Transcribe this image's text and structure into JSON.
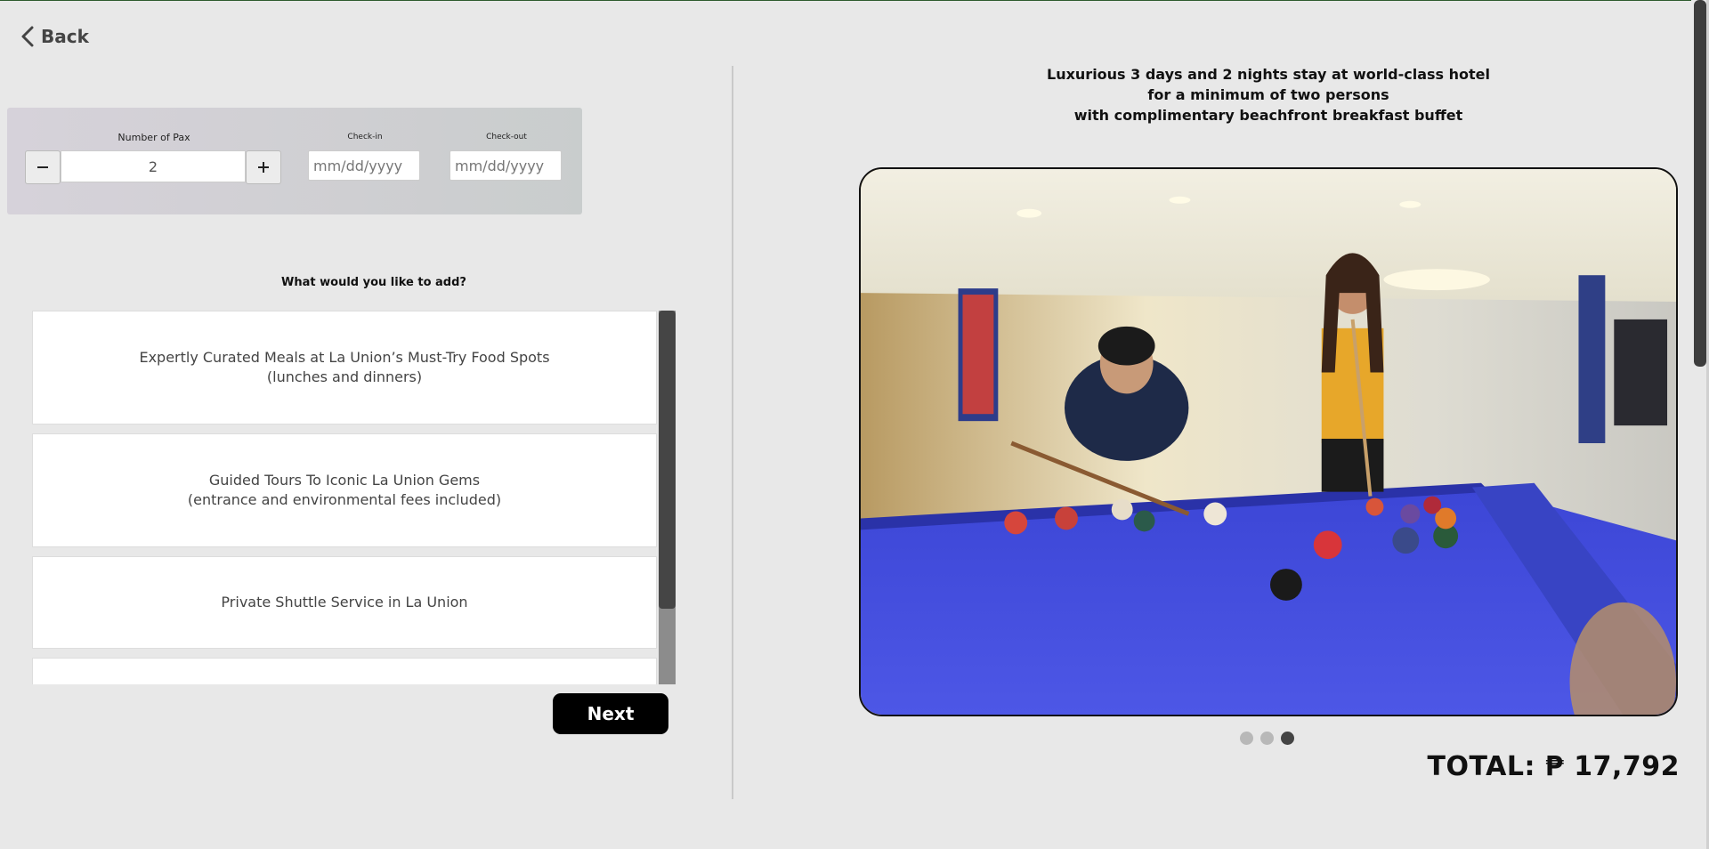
{
  "nav": {
    "back_label": "Back"
  },
  "booking": {
    "pax_label": "Number of Pax",
    "pax_value": "2",
    "checkin_label": "Check-in",
    "checkin_placeholder": "mm/dd/yyyy",
    "checkout_label": "Check-out",
    "checkout_placeholder": "mm/dd/yyyy"
  },
  "addons": {
    "question": "What would you like to add?",
    "items": [
      {
        "line1": "Expertly Curated Meals at La Union’s Must-Try Food Spots",
        "line2": "(lunches and dinners)"
      },
      {
        "line1": "Guided Tours To Iconic La Union Gems",
        "line2": "(entrance and environmental fees included)"
      },
      {
        "line1": "Private Shuttle Service in La Union",
        "line2": ""
      },
      {
        "line1": "",
        "line2": ""
      }
    ]
  },
  "next_label": "Next",
  "package": {
    "title_line1": "Luxurious 3 days and 2 nights stay at world-class hotel",
    "title_line2": "for a minimum of two persons",
    "title_line3": "with complimentary beachfront breakfast buffet"
  },
  "carousel": {
    "slides": 3,
    "active_index": 2
  },
  "total_text": "TOTAL: ₱ 17,792",
  "colors": {
    "accent": "#000000",
    "table_felt": "#3a48d8"
  }
}
